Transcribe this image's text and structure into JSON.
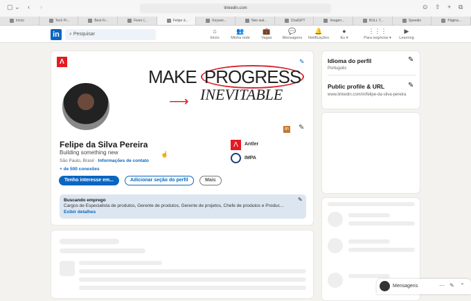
{
  "browser": {
    "url": "linkedin.com",
    "tabs": [
      "Início",
      "Tech Pr...",
      "Best Fr...",
      "Fiverr (...",
      "Felipe d...",
      "Keywor...",
      "Neo wal...",
      "ChatGPT",
      "Imagen...",
      "BULL T...",
      "Speedio",
      "Página..."
    ],
    "active_tab": 4
  },
  "nav": {
    "search_placeholder": "Pesquisar",
    "items": [
      {
        "label": "Início",
        "icon": "⌂"
      },
      {
        "label": "Minha rede",
        "icon": "👥"
      },
      {
        "label": "Vagas",
        "icon": "💼"
      },
      {
        "label": "Mensagens",
        "icon": "💬"
      },
      {
        "label": "Notificações",
        "icon": "🔔"
      },
      {
        "label": "Eu ▾",
        "icon": "●"
      },
      {
        "label": "Para negócios ▾",
        "icon": "⋮⋮⋮"
      },
      {
        "label": "Learning",
        "icon": "▶"
      }
    ]
  },
  "banner": {
    "line1a": "MAKE ",
    "line1b": "PROGRESS",
    "line2": "INEVITABLE"
  },
  "profile": {
    "name": "Felipe da Silva Pereira",
    "headline": "Building something new",
    "location": "São Paulo, Brasil · ",
    "contact": "Informações de contato",
    "connections": "+ de 500 conexões",
    "buttons": [
      "Tenho interesse em...",
      "Adicionar seção do perfil",
      "Mais"
    ],
    "orgs": [
      "Antler",
      "IMPA"
    ]
  },
  "open_to_work": {
    "title": "Buscando emprego",
    "roles": "Cargos de Especialista de produtos, Gerente de produtos, Gerente de projetos, Chefe de produtos e Produc...",
    "link": "Exibir detalhes"
  },
  "sidebar": {
    "language_title": "Idioma do perfil",
    "language": "Português",
    "url_title": "Public profile & URL",
    "url": "www.linkedin.com/in/felipe-da-silva-pereira"
  },
  "messaging": {
    "label": "Mensagens"
  }
}
